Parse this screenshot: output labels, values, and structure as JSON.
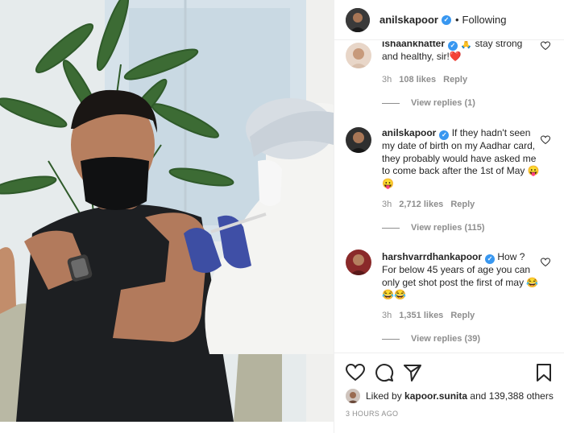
{
  "post": {
    "author": "anilskapoor",
    "separator": "•",
    "follow_status": "Following"
  },
  "comments": [
    {
      "user": "ishaankhatter",
      "text": "🙏 stay strong and healthy, sir!❤️",
      "time": "3h",
      "likes": "108 likes",
      "reply_label": "Reply",
      "view_replies": "View replies (1)"
    },
    {
      "user": "anilskapoor",
      "text": "If they hadn't seen my date of birth on my Aadhar card, they probably would have asked me to come back after the 1st of May 😛😛",
      "time": "3h",
      "likes": "2,712 likes",
      "reply_label": "Reply",
      "view_replies": "View replies (115)"
    },
    {
      "user": "harshvarrdhankapoor",
      "text": "How ? For below 45 years of age you can only get shot post the first of may 😂😂😂",
      "time": "3h",
      "likes": "1,351 likes",
      "reply_label": "Reply",
      "view_replies": "View replies (39)"
    }
  ],
  "likes_summary": {
    "prefix": "Liked by",
    "liker": "kapoor.sunita",
    "rest": "and 139,388 others"
  },
  "posted_ago": "3 HOURS AGO",
  "icons": {
    "verified": "verified-badge",
    "like": "heart-icon",
    "comment": "comment-icon",
    "share": "share-icon",
    "save": "bookmark-icon"
  },
  "colors": {
    "verified": "#3897f0",
    "muted": "#8e8e8e",
    "text": "#262626"
  }
}
